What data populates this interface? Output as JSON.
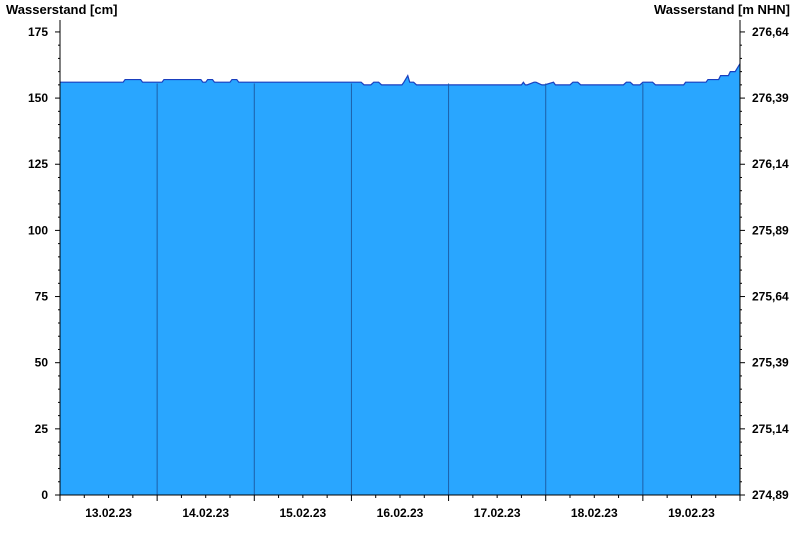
{
  "chart_data": {
    "type": "area",
    "title": "",
    "ylabel_left": "Wasserstand [cm]",
    "ylabel_right": "Wasserstand [m NHN]",
    "ylim": [
      0,
      178
    ],
    "yticks_left": [
      0,
      25,
      50,
      75,
      100,
      125,
      150,
      175
    ],
    "yticks_right": [
      "274,89",
      "275,14",
      "275,39",
      "275,64",
      "275,89",
      "276,14",
      "276,39",
      "276,64"
    ],
    "yticks_right_values": [
      0,
      25,
      50,
      75,
      100,
      125,
      150,
      175
    ],
    "day_labels": [
      "13.02.23",
      "14.02.23",
      "15.02.23",
      "16.02.23",
      "17.02.23",
      "18.02.23",
      "19.02.23"
    ],
    "x_range_days": [
      0,
      7
    ],
    "grid": false,
    "fill_color": "#29a6ff",
    "line_color": "#1a3fbf",
    "divider_color": "#1d5fa8",
    "series": [
      {
        "x": [
          0,
          0.65,
          0.67,
          0.83,
          0.85,
          1.05,
          1.07,
          1.45,
          1.47,
          1.5,
          1.52,
          1.57,
          1.59,
          1.75,
          1.77,
          1.82,
          1.84,
          3.1,
          3.13,
          3.2,
          3.23,
          3.28,
          3.31,
          3.52,
          3.54,
          3.58,
          3.6,
          3.64,
          3.67,
          3.72,
          3.75,
          4.75,
          4.77,
          4.79,
          4.81,
          4.88,
          4.9,
          4.96,
          4.99,
          5.08,
          5.1,
          5.25,
          5.28,
          5.33,
          5.36,
          5.8,
          5.83,
          5.87,
          5.9,
          5.97,
          6.0,
          6.1,
          6.13,
          6.42,
          6.44,
          6.65,
          6.67,
          6.78,
          6.8,
          6.88,
          6.9,
          6.95,
          7.0
        ],
        "values": [
          156,
          156,
          157,
          157,
          156,
          156,
          157,
          157,
          156,
          156,
          157,
          157,
          156,
          156,
          157,
          157,
          156,
          156,
          155,
          155,
          156,
          156,
          155,
          155,
          156,
          158.5,
          156,
          156,
          155,
          155,
          155,
          155,
          156,
          155,
          155,
          156,
          156,
          155,
          155,
          156,
          155,
          155,
          156,
          156,
          155,
          155,
          156,
          156,
          155,
          155,
          156,
          156,
          155,
          155,
          156,
          156,
          157,
          157,
          158.5,
          158.5,
          160,
          160,
          163
        ]
      }
    ]
  }
}
